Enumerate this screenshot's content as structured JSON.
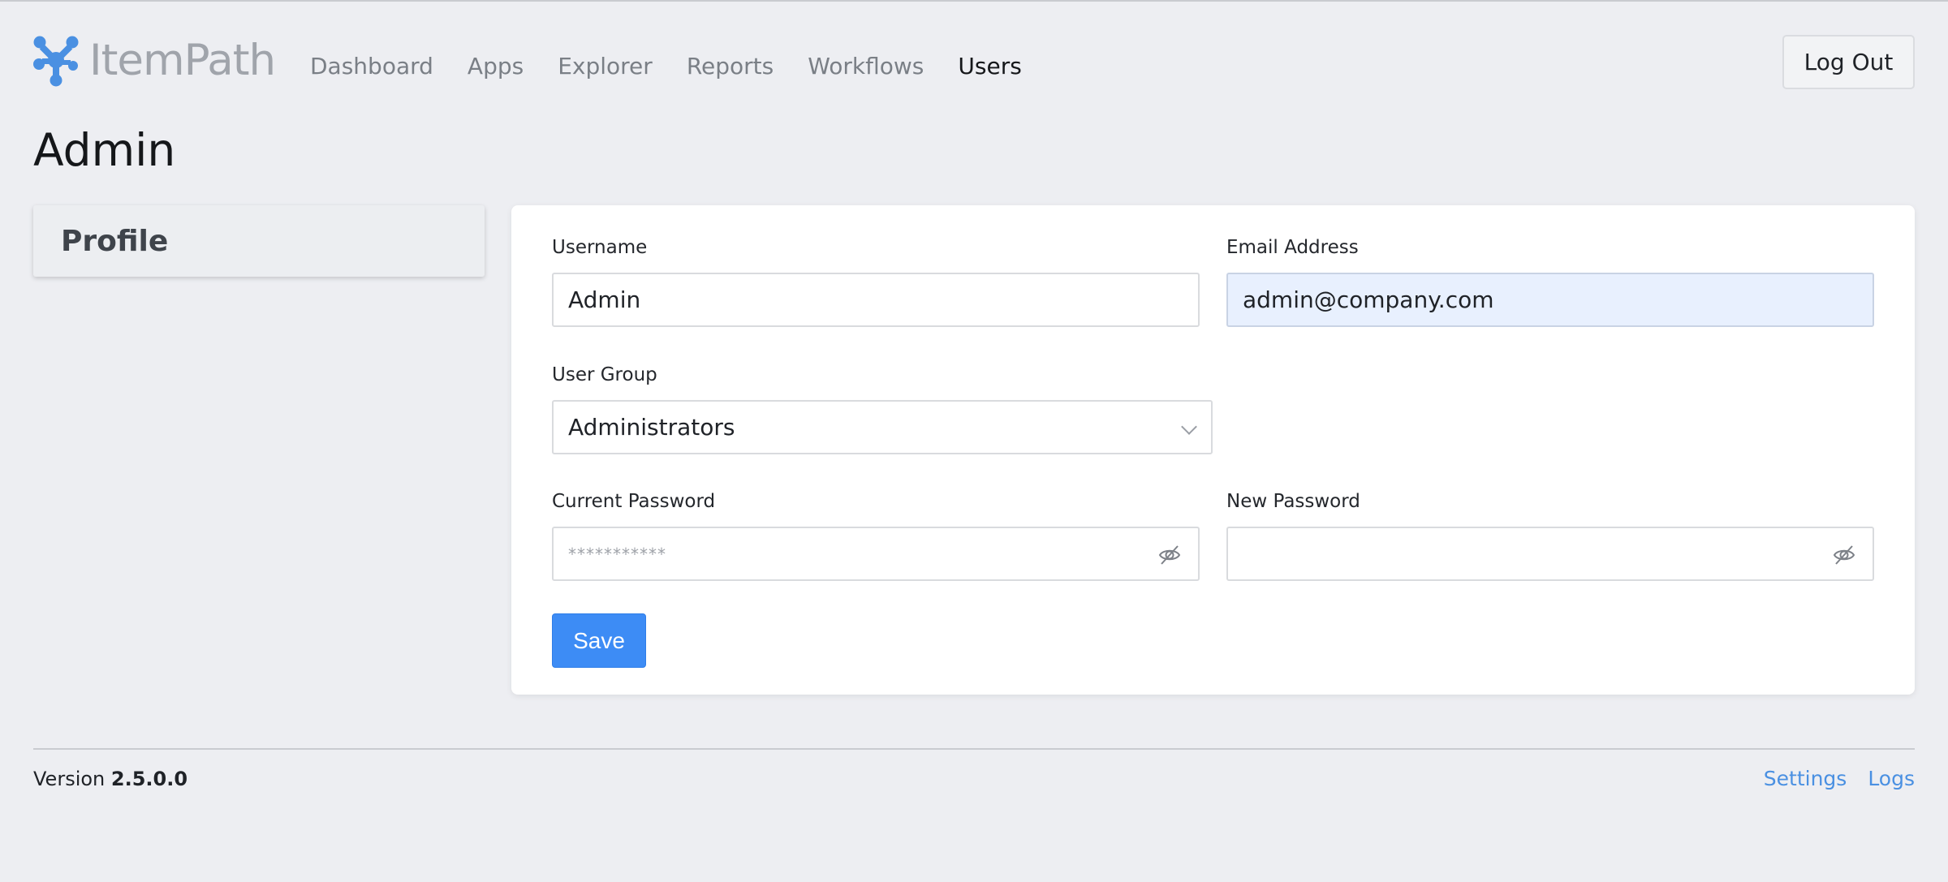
{
  "brand": {
    "name": "ItemPath",
    "logo_icon": "itempath-molecule-icon",
    "logo_color": "#4a90e2"
  },
  "nav": {
    "items": [
      {
        "label": "Dashboard",
        "active": false
      },
      {
        "label": "Apps",
        "active": false
      },
      {
        "label": "Explorer",
        "active": false
      },
      {
        "label": "Reports",
        "active": false
      },
      {
        "label": "Workflows",
        "active": false
      },
      {
        "label": "Users",
        "active": true
      }
    ],
    "logout_label": "Log Out"
  },
  "page": {
    "title": "Admin"
  },
  "sidebar": {
    "items": [
      {
        "label": "Profile"
      }
    ]
  },
  "form": {
    "username": {
      "label": "Username",
      "value": "Admin"
    },
    "email": {
      "label": "Email Address",
      "value": "admin@company.com"
    },
    "user_group": {
      "label": "User Group",
      "value": "Administrators"
    },
    "current_password": {
      "label": "Current Password",
      "value": "***********",
      "toggle_icon": "eye-slash-icon"
    },
    "new_password": {
      "label": "New Password",
      "value": "",
      "toggle_icon": "eye-slash-icon"
    },
    "save_label": "Save"
  },
  "footer": {
    "version_label": "Version",
    "version_value": "2.5.0.0",
    "links": [
      {
        "label": "Settings"
      },
      {
        "label": "Logs"
      }
    ]
  },
  "colors": {
    "background": "#edeef2",
    "accent": "#3d8cf5",
    "link": "#4a90e2",
    "autofill": "#e8f0fe"
  }
}
